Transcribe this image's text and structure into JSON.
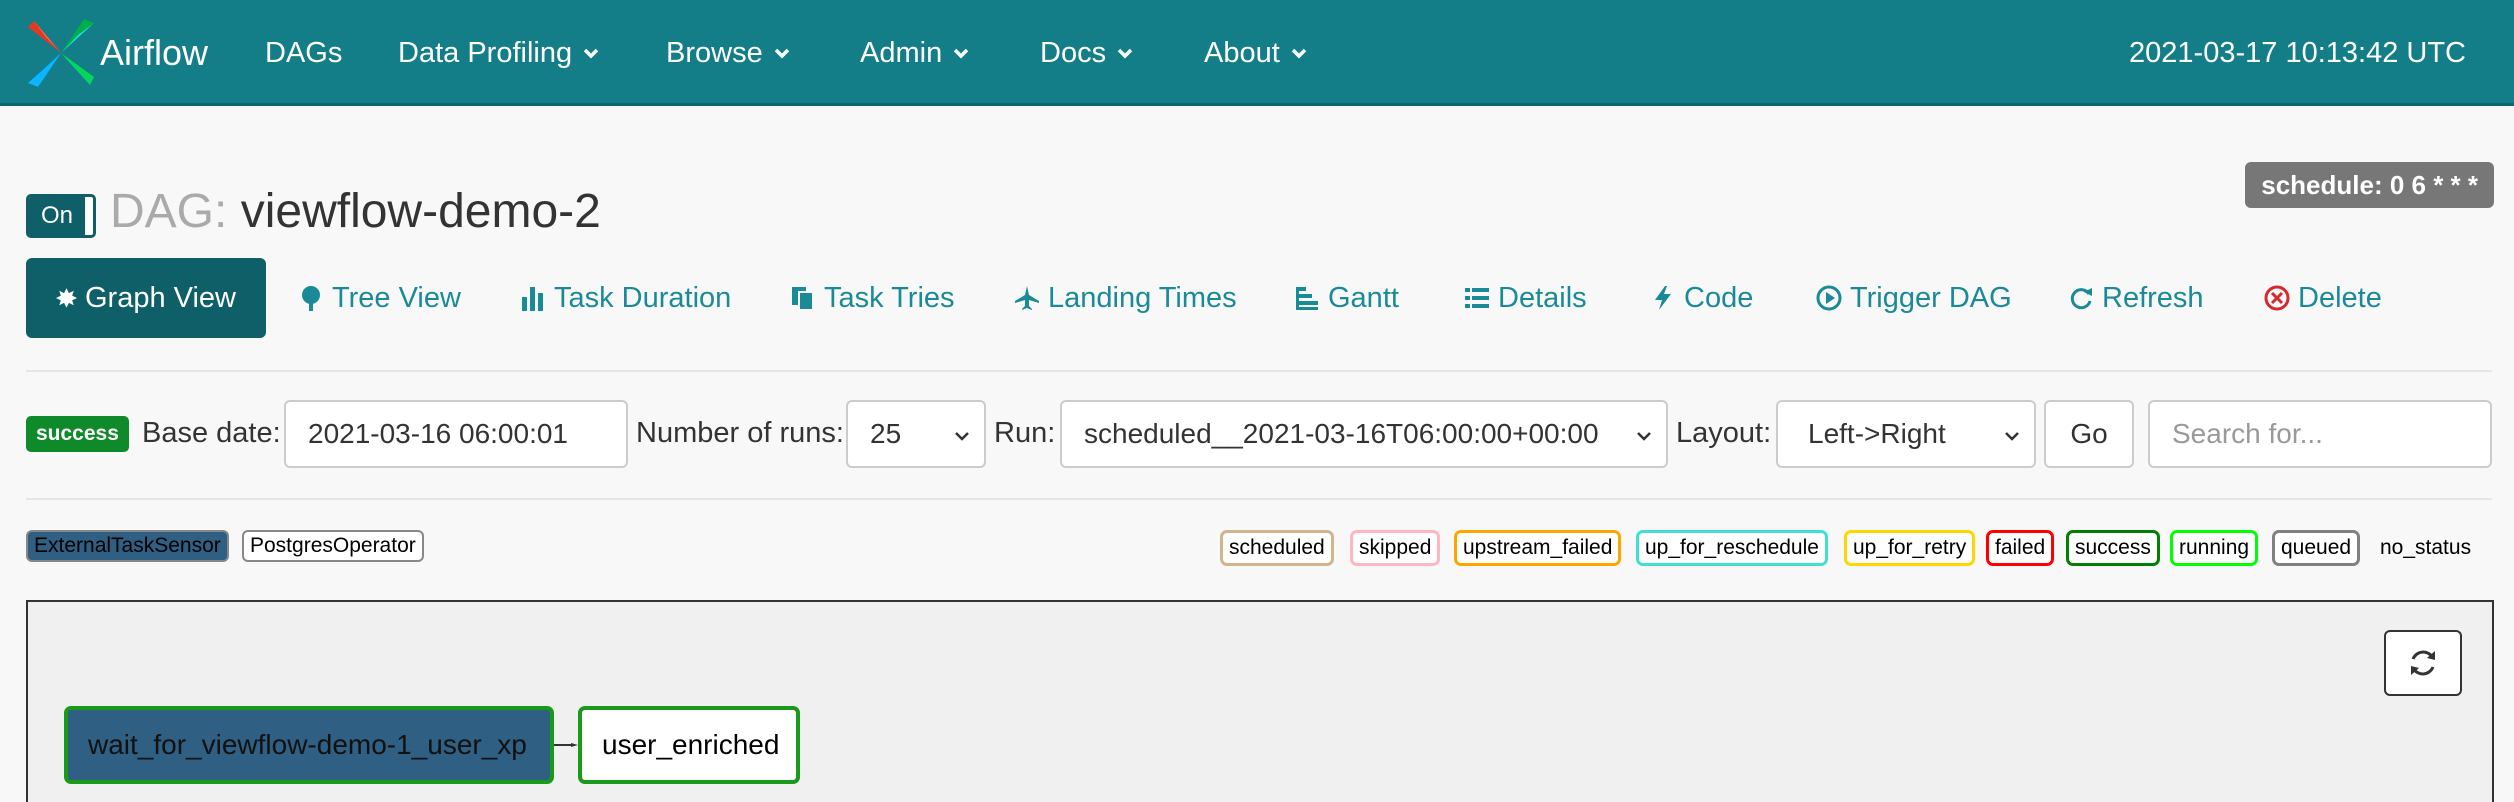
{
  "navbar": {
    "brand": "Airflow",
    "items": [
      "DAGs",
      "Data Profiling",
      "Browse",
      "Admin",
      "Docs",
      "About"
    ],
    "time": "2021-03-17 10:13:42 UTC"
  },
  "dag": {
    "toggle": "On",
    "prefix": "DAG:",
    "name": "viewflow-demo-2",
    "schedule": "schedule: 0 6 * * *"
  },
  "tabs": [
    "Graph View",
    "Tree View",
    "Task Duration",
    "Task Tries",
    "Landing Times",
    "Gantt",
    "Details",
    "Code",
    "Trigger DAG",
    "Refresh",
    "Delete"
  ],
  "controls": {
    "state_badge": "success",
    "base_date_label": "Base date:",
    "base_date_value": "2021-03-16 06:00:01",
    "runs_label": "Number of runs:",
    "runs_value": "25",
    "run_label": "Run:",
    "run_value": "scheduled__2021-03-16T06:00:00+00:00",
    "layout_label": "Layout:",
    "layout_value": "Left->Right",
    "go_label": "Go",
    "search_placeholder": "Search for..."
  },
  "legend": {
    "operators": [
      "ExternalTaskSensor",
      "PostgresOperator"
    ],
    "states": [
      "scheduled",
      "skipped",
      "upstream_failed",
      "up_for_reschedule",
      "up_for_retry",
      "failed",
      "success",
      "running",
      "queued",
      "no_status"
    ],
    "state_colors": {
      "scheduled": "#d2b48c",
      "skipped": "#ffb6c1",
      "upstream_failed": "#ffa500",
      "up_for_reschedule": "#40e0d0",
      "up_for_retry": "#ffd700",
      "failed": "#ff0000",
      "success": "#008000",
      "running": "#00ff00",
      "queued": "#808080"
    }
  },
  "graph": {
    "nodes": [
      "wait_for_viewflow-demo-1_user_xp",
      "user_enriched"
    ]
  },
  "colors": {
    "navbar": "#137d88",
    "accent": "#0e5f68",
    "link": "#1a8a96",
    "sensor_node": "#2f5f82"
  }
}
